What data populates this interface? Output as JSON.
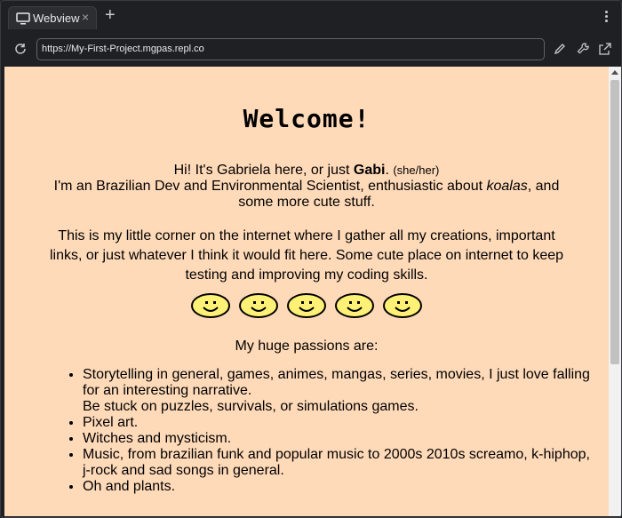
{
  "browser": {
    "tab_title": "Webview",
    "tab_close": "×",
    "new_tab": "+",
    "url": "https://My-First-Project.mgpas.repl.co",
    "icons": [
      "monitor-icon",
      "reload-icon",
      "pencil-icon",
      "wrench-icon",
      "open-external-icon",
      "more-icon"
    ]
  },
  "page": {
    "background": "#ffdab9",
    "welcome": "Welcome!",
    "intro_prefix": "Hi! It's Gabriela here, or just ",
    "intro_name": "Gabi",
    "intro_dot": ".",
    "intro_pronouns": "(she/her)",
    "intro_line2_a": "I'm an Brazilian Dev and Environmental Scientist, enthusiastic about ",
    "intro_line2_em": "koalas",
    "intro_line2_b": ", and some more cute stuff.",
    "corner_text": "This is my little corner on the internet where I gather all my creations, important links, or just whatever I think it would fit here. Some cute place on internet to keep testing and improving my coding skills.",
    "smiley_count": 5,
    "passions_heading": "My huge passions are:",
    "passions": {
      "item1_a": "Storytelling in general, games, animes, mangas, series, movies, I just love falling for an interesting narrative.",
      "item1_b": "Be stuck on puzzles, survivals, or simulations games.",
      "item2": "Pixel art.",
      "item3": "Witches and mysticism.",
      "item4": "Music, from brazilian funk and popular music to 2000s 2010s screamo, k-hiphop, j-rock and sad songs in general.",
      "item5": "Oh and plants."
    }
  }
}
